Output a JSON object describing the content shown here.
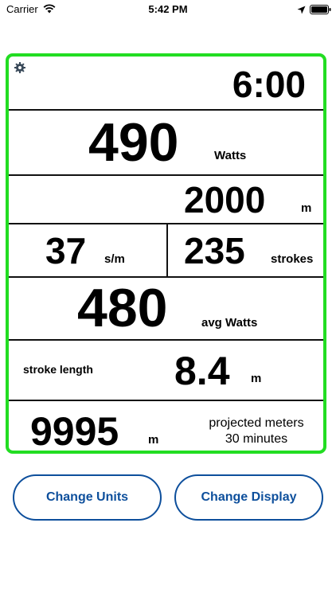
{
  "status_bar": {
    "carrier": "Carrier",
    "time": "5:42 PM"
  },
  "panel": {
    "time": "6:00",
    "power": {
      "value": "490",
      "unit": "Watts"
    },
    "distance": {
      "value": "2000",
      "unit": "m"
    },
    "stroke_rate": {
      "value": "37",
      "unit": "s/m"
    },
    "strokes": {
      "value": "235",
      "unit": "strokes"
    },
    "avg_power": {
      "value": "480",
      "unit": "avg Watts"
    },
    "stroke_length": {
      "label": "stroke length",
      "value": "8.4",
      "unit": "m"
    },
    "projected": {
      "value": "9995",
      "unit": "m",
      "label_line1": "projected meters",
      "label_line2": "30 minutes"
    }
  },
  "buttons": {
    "change_units": "Change Units",
    "change_display": "Change Display"
  },
  "colors": {
    "panel_border": "#22dd22",
    "button_accent": "#0d4f9c"
  },
  "icons": [
    "wifi-icon",
    "location-arrow-icon",
    "battery-icon",
    "gear-icon"
  ]
}
